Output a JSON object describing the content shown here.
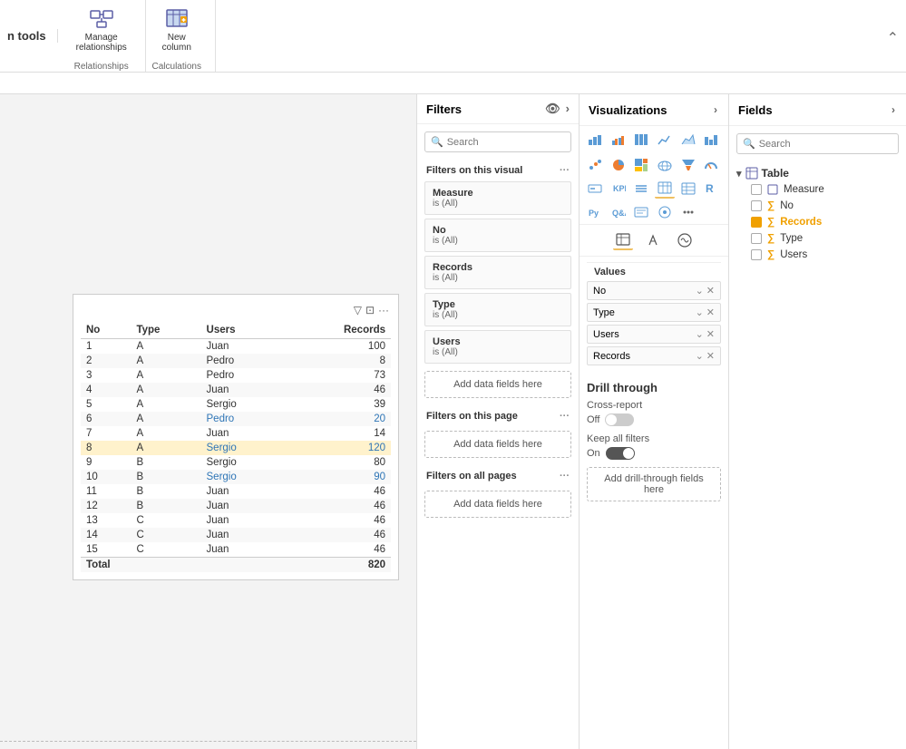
{
  "toolbar": {
    "title": "n tools",
    "groups": [
      {
        "name": "Relationships",
        "buttons": [
          {
            "id": "manage-relationships",
            "label": "Manage\nrelationships",
            "icon": "⊞"
          }
        ]
      },
      {
        "name": "Calculations",
        "buttons": [
          {
            "id": "new-column",
            "label": "New\ncolumn",
            "icon": "⊞"
          }
        ]
      }
    ]
  },
  "filters": {
    "title": "Filters",
    "search_placeholder": "Search",
    "visual_section": "Filters on this visual",
    "page_section": "Filters on this page",
    "all_pages_section": "Filters on all pages",
    "add_fields_label": "Add data fields here",
    "filters": [
      {
        "name": "Measure",
        "value": "is (All)"
      },
      {
        "name": "No",
        "value": "is (All)"
      },
      {
        "name": "Records",
        "value": "is (All)"
      },
      {
        "name": "Type",
        "value": "is (All)"
      },
      {
        "name": "Users",
        "value": "is (All)"
      }
    ]
  },
  "visualizations": {
    "title": "Visualizations",
    "values_label": "Values",
    "values": [
      {
        "name": "No",
        "id": "val-no"
      },
      {
        "name": "Type",
        "id": "val-type"
      },
      {
        "name": "Users",
        "id": "val-users"
      },
      {
        "name": "Records",
        "id": "val-records"
      }
    ],
    "drill_through": {
      "title": "Drill through",
      "cross_report_label": "Cross-report",
      "cross_report_state": "off",
      "keep_filters_label": "Keep all filters",
      "keep_filters_state": "on",
      "add_fields_label": "Add drill-through fields here"
    }
  },
  "fields": {
    "title": "Fields",
    "search_placeholder": "Search",
    "groups": [
      {
        "name": "Table",
        "icon": "table",
        "items": [
          {
            "name": "Measure",
            "icon": "table",
            "checked": false
          },
          {
            "name": "No",
            "icon": "sigma",
            "checked": false
          },
          {
            "name": "Records",
            "icon": "sigma",
            "checked": true,
            "highlighted": true
          },
          {
            "name": "Type",
            "icon": "sigma",
            "checked": false
          },
          {
            "name": "Users",
            "icon": "sigma",
            "checked": false
          }
        ]
      }
    ]
  },
  "table": {
    "columns": [
      "No",
      "Type",
      "Users",
      "Records"
    ],
    "rows": [
      {
        "no": 1,
        "type": "A",
        "users": "Juan",
        "records": 100,
        "highlight": false
      },
      {
        "no": 2,
        "type": "A",
        "users": "Pedro",
        "records": 8,
        "highlight": false
      },
      {
        "no": 3,
        "type": "A",
        "users": "Pedro",
        "records": 73,
        "highlight": false
      },
      {
        "no": 4,
        "type": "A",
        "users": "Juan",
        "records": 46,
        "highlight": false
      },
      {
        "no": 5,
        "type": "A",
        "users": "Sergio",
        "records": 39,
        "highlight": false
      },
      {
        "no": 6,
        "type": "A",
        "users": "Pedro",
        "records": 20,
        "highlight": false,
        "blue": true
      },
      {
        "no": 7,
        "type": "A",
        "users": "Juan",
        "records": 14,
        "highlight": false
      },
      {
        "no": 8,
        "type": "A",
        "users": "Sergio",
        "records": 120,
        "highlight": true,
        "blue": true
      },
      {
        "no": 9,
        "type": "B",
        "users": "Sergio",
        "records": 80,
        "highlight": false
      },
      {
        "no": 10,
        "type": "B",
        "users": "Sergio",
        "records": 90,
        "highlight": false,
        "blue": true
      },
      {
        "no": 11,
        "type": "B",
        "users": "Juan",
        "records": 46,
        "highlight": false
      },
      {
        "no": 12,
        "type": "B",
        "users": "Juan",
        "records": 46,
        "highlight": false
      },
      {
        "no": 13,
        "type": "C",
        "users": "Juan",
        "records": 46,
        "highlight": false
      },
      {
        "no": 14,
        "type": "C",
        "users": "Juan",
        "records": 46,
        "highlight": false
      },
      {
        "no": 15,
        "type": "C",
        "users": "Juan",
        "records": 46,
        "highlight": false
      }
    ],
    "total_label": "Total",
    "total_records": 820
  }
}
